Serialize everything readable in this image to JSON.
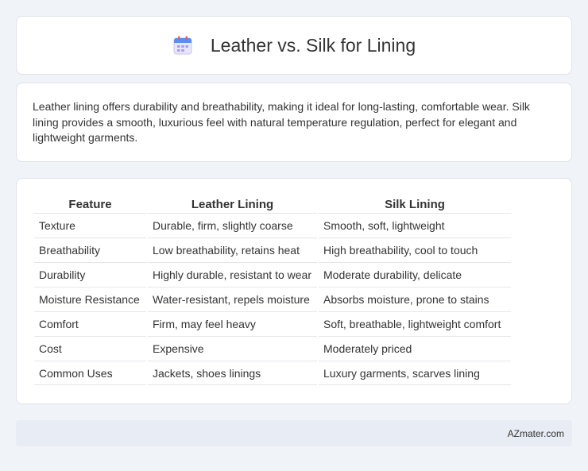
{
  "header": {
    "icon": "calendar-icon",
    "title": "Leather vs. Silk for Lining"
  },
  "intro": {
    "text": "Leather lining offers durability and breathability, making it ideal for long-lasting, comfortable wear. Silk lining provides a smooth, luxurious feel with natural temperature regulation, perfect for elegant and lightweight garments."
  },
  "table": {
    "headers": [
      "Feature",
      "Leather Lining",
      "Silk Lining"
    ],
    "rows": [
      [
        "Texture",
        "Durable, firm, slightly coarse",
        "Smooth, soft, lightweight"
      ],
      [
        "Breathability",
        "Low breathability, retains heat",
        "High breathability, cool to touch"
      ],
      [
        "Durability",
        "Highly durable, resistant to wear",
        "Moderate durability, delicate"
      ],
      [
        "Moisture Resistance",
        "Water-resistant, repels moisture",
        "Absorbs moisture, prone to stains"
      ],
      [
        "Comfort",
        "Firm, may feel heavy",
        "Soft, breathable, lightweight comfort"
      ],
      [
        "Cost",
        "Expensive",
        "Moderately priced"
      ],
      [
        "Common Uses",
        "Jackets, shoes linings",
        "Luxury garments, scarves lining"
      ]
    ]
  },
  "footer": {
    "text": "AZmater.com"
  }
}
